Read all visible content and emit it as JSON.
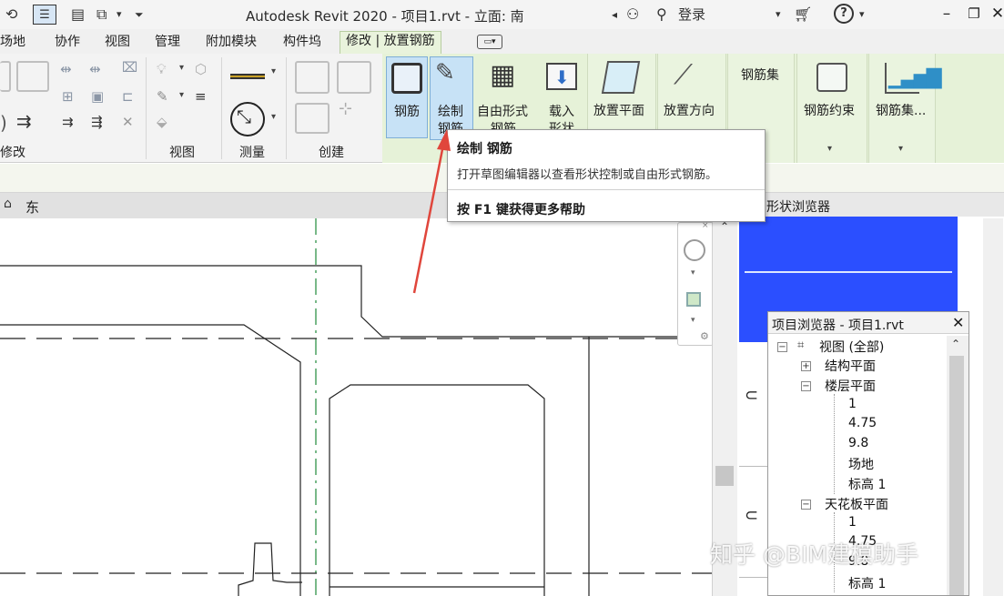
{
  "titlebar": {
    "app_title": "Autodesk Revit 2020 - 项目1.rvt - 立面: 南",
    "signin": "登录",
    "nav_arrow": "◂"
  },
  "tabs": [
    {
      "label": "场地"
    },
    {
      "label": "协作"
    },
    {
      "label": "视图"
    },
    {
      "label": "管理"
    },
    {
      "label": "附加模块"
    },
    {
      "label": "构件坞"
    },
    {
      "label": "修改 | 放置钢筋"
    }
  ],
  "ribbon": {
    "panels": {
      "modify": "修改",
      "view": "视图",
      "measure": "测量",
      "create": "创建"
    },
    "buttons": {
      "rebar": "钢筋",
      "sketch_line1": "绘制",
      "sketch_line2": "钢筋",
      "freeform_line1": "自由形式",
      "freeform_line2": "钢筋",
      "load_line1": "载入",
      "load_line2": "形状",
      "place_plane": "放置平面",
      "place_direction": "放置方向",
      "rebar_set_label": "钢筋集",
      "rebar_constraint": "钢筋约束",
      "rebar_set_btn": "钢筋集..."
    }
  },
  "tooltip": {
    "title": "绘制 钢筋",
    "description": "打开草图编辑器以查看形状控制或自由形式钢筋。",
    "help": "按 F1 键获得更多帮助"
  },
  "view_tab": {
    "label": "东"
  },
  "shape_browser": {
    "title": "形状浏览器"
  },
  "project_browser": {
    "title": "项目浏览器 - 项目1.rvt",
    "tree": [
      {
        "label": "视图 (全部)",
        "toggle": "−"
      },
      {
        "label": "结构平面",
        "toggle": "+"
      },
      {
        "label": "楼层平面",
        "toggle": "−"
      },
      {
        "label": "1"
      },
      {
        "label": "4.75"
      },
      {
        "label": "9.8"
      },
      {
        "label": "场地"
      },
      {
        "label": "标高 1"
      },
      {
        "label": "天花板平面",
        "toggle": "−"
      },
      {
        "label": "1"
      },
      {
        "label": "4.75"
      },
      {
        "label": "9.8"
      },
      {
        "label": "标高 1"
      }
    ]
  },
  "watermark": {
    "text": "知乎 @BIM建模助手"
  },
  "colors": {
    "ribbon_context": "#e6f2d8",
    "selected_button": "#c7e2f6",
    "shape_preview": "#2b4fff",
    "arrow": "#e0463c"
  }
}
